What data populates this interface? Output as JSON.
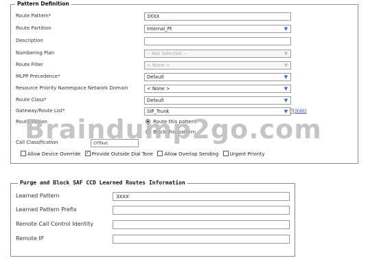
{
  "pattern_definition": {
    "legend": "Pattern Definition",
    "fields": [
      {
        "label": "Route Pattern*",
        "value": "3XXX",
        "type": "text"
      },
      {
        "label": "Route Partition",
        "value": "Internal_Pt",
        "type": "select"
      },
      {
        "label": "Description",
        "value": "",
        "type": "text"
      },
      {
        "label": "Numbering Plan",
        "value": "-- Not Selected --",
        "type": "select-disabled"
      },
      {
        "label": "Route Filter",
        "value": "< None >",
        "type": "select-disabled"
      },
      {
        "label": "MLPP Precedence*",
        "value": "Default",
        "type": "select"
      },
      {
        "label": "Resource Priority Namespace Network Domain",
        "value": "< None >",
        "type": "select"
      },
      {
        "label": "Route Class*",
        "value": "Default",
        "type": "select"
      },
      {
        "label": "Gateway/Route List*",
        "value": "SIP_Trunk",
        "type": "select"
      }
    ],
    "edit_link": "(Edit)",
    "route_option_label": "Route Option",
    "route_option_choices": [
      "Route this pattern",
      "Block this pattern"
    ],
    "route_option_selected": 0,
    "calling_party_label": "Call Classification",
    "calling_party_value": "OffNet",
    "checkboxes": [
      {
        "label": "Allow Device Override",
        "checked": false
      },
      {
        "label": "Provide Outside Dial Tone",
        "checked": true
      },
      {
        "label": "Allow Overlap Sending",
        "checked": false
      },
      {
        "label": "Urgent Priority",
        "checked": false
      }
    ],
    "watermark": "Braindump2go.com"
  },
  "saf_section": {
    "legend": "Purge and Block SAF CCD Learned Routes Information",
    "fields": [
      {
        "label": "Learned Pattern",
        "value": "3XXX"
      },
      {
        "label": "Learned Pattern Prefix",
        "value": ""
      },
      {
        "label": "Remote Call Control Identity",
        "value": ""
      },
      {
        "label": "Remote IP",
        "value": ""
      }
    ]
  },
  "colors": {
    "link": "#2a4fb3",
    "caret": "#3366cc",
    "border": "#8a8a8a"
  }
}
